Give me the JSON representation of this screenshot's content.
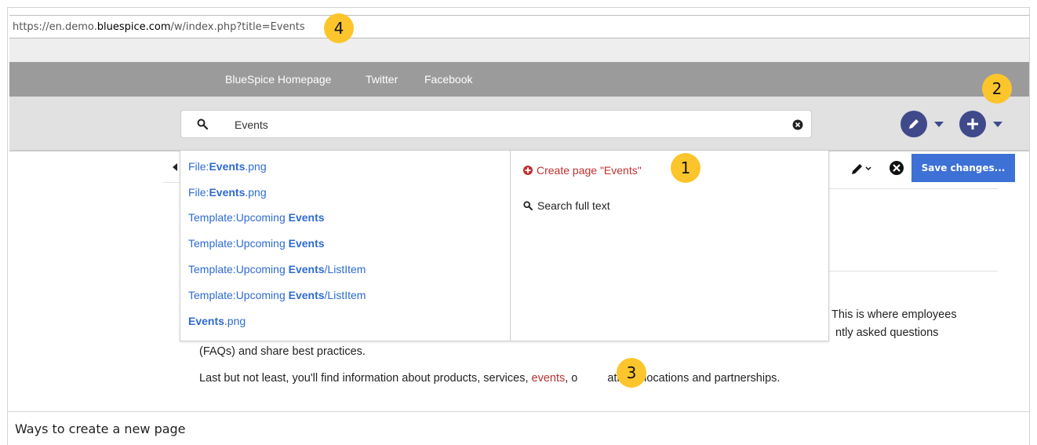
{
  "url": {
    "prefix": "https://en.demo.",
    "domain": "bluespice.com",
    "suffix": "/w/index.php?title=Events"
  },
  "topnav": {
    "items": [
      "BlueSpice Homepage",
      "Twitter",
      "Facebook"
    ]
  },
  "search": {
    "value": "Events"
  },
  "editor": {
    "save_label": "Save changes..."
  },
  "dropdown": {
    "results": [
      {
        "pre": "File:",
        "match": "Events",
        "post": ".png"
      },
      {
        "pre": "File:",
        "match": "Events",
        "post": ".png"
      },
      {
        "pre": "Template:Upcoming ",
        "match": "Events",
        "post": ""
      },
      {
        "pre": "Template:Upcoming ",
        "match": "Events",
        "post": ""
      },
      {
        "pre": "Template:Upcoming ",
        "match": "Events",
        "post": "/ListItem"
      },
      {
        "pre": "Template:Upcoming ",
        "match": "Events",
        "post": "/ListItem"
      },
      {
        "pre": "",
        "match": "Events",
        "post": ".png"
      }
    ],
    "create_label": "Create page \"Events\"",
    "fulltext_label": "Search full text"
  },
  "content": {
    "line1_tail": "This is where employees",
    "line2_tail": "ntly asked questions",
    "line3": "(FAQs) and share best practices.",
    "line4_pre": "Last but not least, you'll find information about products, services, ",
    "line4_link": "events",
    "line4_mid": ", o",
    "line4_post": "ations, locations and partnerships."
  },
  "badges": [
    "1",
    "2",
    "3",
    "4"
  ],
  "caption": "Ways to create a new page",
  "colors": {
    "accent": "#3e4a8a",
    "save": "#3e71d6",
    "link": "#2e6bd0",
    "red_link": "#b83232",
    "badge": "#fbc52b"
  }
}
